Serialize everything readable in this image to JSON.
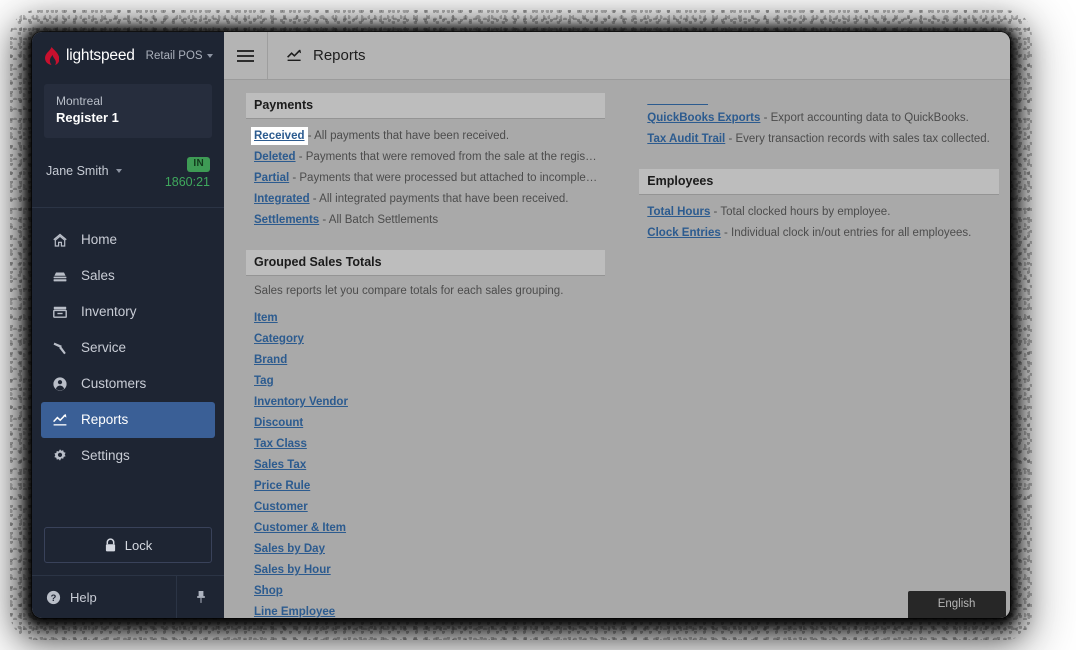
{
  "brand": {
    "name": "lightspeed",
    "product": "Retail POS",
    "logo_icon": "flame-icon",
    "caret_icon": "chevron-down-icon"
  },
  "sidebar": {
    "register": {
      "location": "Montreal",
      "name": "Register 1"
    },
    "user": {
      "name": "Jane Smith",
      "caret_icon": "chevron-down-icon",
      "status_badge": "IN",
      "clock_time": "1860:21",
      "badge_color": "#3e9b55",
      "time_color": "#3fa85d"
    },
    "nav": [
      {
        "label": "Home",
        "icon": "home-icon",
        "active": false
      },
      {
        "label": "Sales",
        "icon": "sales-icon",
        "active": false
      },
      {
        "label": "Inventory",
        "icon": "inventory-icon",
        "active": false
      },
      {
        "label": "Service",
        "icon": "wrench-icon",
        "active": false
      },
      {
        "label": "Customers",
        "icon": "person-icon",
        "active": false
      },
      {
        "label": "Reports",
        "icon": "chart-icon",
        "active": true
      },
      {
        "label": "Settings",
        "icon": "gear-icon",
        "active": false
      }
    ],
    "lock_label": "Lock",
    "lock_icon": "lock-icon",
    "help_label": "Help",
    "help_icon": "help-circle-icon",
    "pin_icon": "pushpin-icon",
    "active_color": "#3a5f96",
    "background_color": "#1e2533"
  },
  "topbar": {
    "menu_icon": "hamburger-menu-icon",
    "page_icon": "chart-icon",
    "page_title": "Reports"
  },
  "main": {
    "left_column": [
      {
        "heading": "Payments",
        "description": "",
        "items": [
          {
            "link": "Received",
            "desc": " - All payments that have been received.",
            "focused": true
          },
          {
            "link": "Deleted",
            "desc": " - Payments that were removed from the sale at the register.",
            "focused": false
          },
          {
            "link": "Partial",
            "desc": " - Payments that were processed but attached to incomplete sales.",
            "focused": false
          },
          {
            "link": "Integrated",
            "desc": " - All integrated payments that have been received.",
            "focused": false
          },
          {
            "link": "Settlements",
            "desc": " - All Batch Settlements",
            "focused": false
          }
        ]
      },
      {
        "heading": "Grouped Sales Totals",
        "description": "Sales reports let you compare totals for each sales grouping.",
        "items": [
          {
            "link": "Item",
            "desc": "",
            "focused": false
          },
          {
            "link": "Category",
            "desc": "",
            "focused": false
          },
          {
            "link": "Brand",
            "desc": "",
            "focused": false
          },
          {
            "link": "Tag",
            "desc": "",
            "focused": false
          },
          {
            "link": "Inventory Vendor",
            "desc": "",
            "focused": false
          },
          {
            "link": "Discount",
            "desc": "",
            "focused": false
          },
          {
            "link": "Tax Class",
            "desc": "",
            "focused": false
          },
          {
            "link": "Sales Tax",
            "desc": "",
            "focused": false
          },
          {
            "link": "Price Rule",
            "desc": "",
            "focused": false
          },
          {
            "link": "Customer",
            "desc": "",
            "focused": false
          },
          {
            "link": "Customer & Item",
            "desc": "",
            "focused": false
          },
          {
            "link": "Sales by Day",
            "desc": "",
            "focused": false
          },
          {
            "link": "Sales by Hour",
            "desc": "",
            "focused": false
          },
          {
            "link": "Shop",
            "desc": "",
            "focused": false
          },
          {
            "link": "Line Employee",
            "desc": "",
            "focused": false
          }
        ]
      }
    ],
    "right_column": [
      {
        "heading": "",
        "description": "",
        "items": [
          {
            "link": "QuickBooks Exports",
            "desc": " - Export accounting data to QuickBooks.",
            "focused": false
          },
          {
            "link": "Tax Audit Trail",
            "desc": " - Every transaction records with sales tax collected.",
            "focused": false
          }
        ]
      },
      {
        "heading": "Employees",
        "description": "",
        "items": [
          {
            "link": "Total Hours",
            "desc": " - Total clocked hours by employee.",
            "focused": false
          },
          {
            "link": "Clock Entries",
            "desc": " - Individual clock in/out entries for all employees.",
            "focused": false
          }
        ]
      }
    ]
  },
  "language_badge": {
    "label": "English"
  }
}
